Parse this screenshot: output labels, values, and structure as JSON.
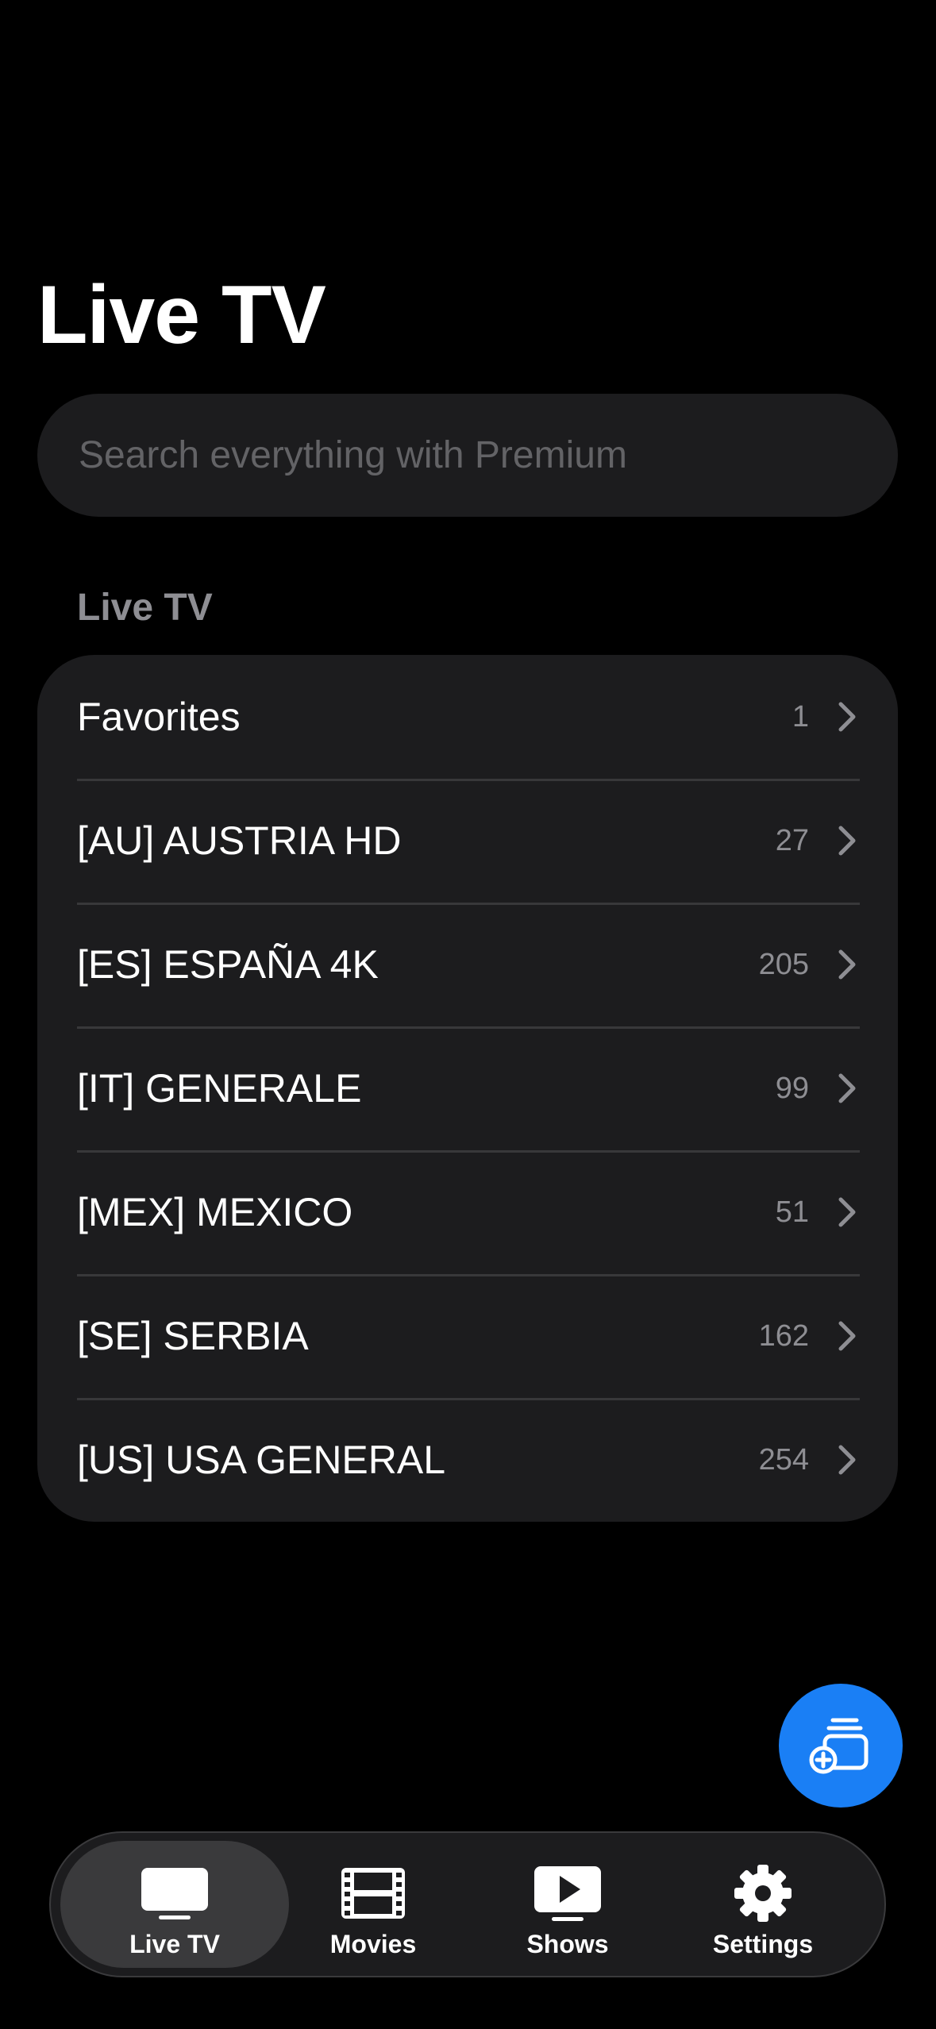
{
  "header": {
    "title": "Live TV"
  },
  "search": {
    "placeholder": "Search everything with Premium"
  },
  "section": {
    "title": "Live TV"
  },
  "categories": [
    {
      "label": "Favorites",
      "count": "1"
    },
    {
      "label": "[AU] AUSTRIA HD",
      "count": "27"
    },
    {
      "label": "[ES] ESPAÑA 4K",
      "count": "205"
    },
    {
      "label": "[IT] GENERALE",
      "count": "99"
    },
    {
      "label": "[MEX] MEXICO",
      "count": "51"
    },
    {
      "label": "[SE] SERBIA",
      "count": "162"
    },
    {
      "label": "[US] USA GENERAL",
      "count": "254"
    }
  ],
  "fab": {
    "icon": "add-playlist-icon"
  },
  "tabs": [
    {
      "label": "Live TV",
      "icon": "tv-icon",
      "active": true
    },
    {
      "label": "Movies",
      "icon": "film-icon",
      "active": false
    },
    {
      "label": "Shows",
      "icon": "play-icon",
      "active": false
    },
    {
      "label": "Settings",
      "icon": "gear-icon",
      "active": false
    }
  ],
  "colors": {
    "background": "#000000",
    "card": "#1c1c1e",
    "accent": "#1a7ff5",
    "secondary_text": "#8e8e93"
  }
}
